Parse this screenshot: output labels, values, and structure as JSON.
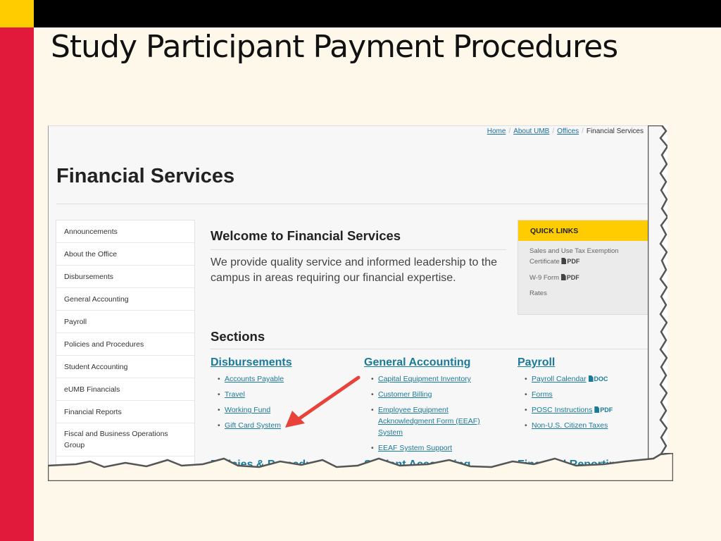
{
  "slide": {
    "title": "Study Participant Payment Procedures",
    "colors": {
      "accent_yellow": "#ffcc00",
      "accent_red": "#e11a3c",
      "top_bar": "#000000",
      "background": "#fdf8ea"
    }
  },
  "website": {
    "breadcrumb": [
      {
        "label": "Home",
        "link": true
      },
      {
        "label": "About UMB",
        "link": true
      },
      {
        "label": "Offices",
        "link": true
      },
      {
        "label": "Financial Services",
        "link": false
      }
    ],
    "breadcrumb_separator": "/",
    "page_title": "Financial Services",
    "sidebar": {
      "items": [
        "Announcements",
        "About the Office",
        "Disbursements",
        "General Accounting",
        "Payroll",
        "Policies and Procedures",
        "Student Accounting",
        "eUMB Financials",
        "Financial Reports",
        "Fiscal and Business Operations Group"
      ]
    },
    "welcome": {
      "title": "Welcome to Financial Services",
      "text": "We provide quality service and informed leadership to the campus in areas requiring our financial expertise."
    },
    "quick_links": {
      "header": "QUICK LINKS",
      "items": [
        {
          "label": "Sales and Use Tax Exemption Certificate",
          "badge": "PDF"
        },
        {
          "label": "W-9 Form",
          "badge": "PDF"
        },
        {
          "label": "Rates",
          "badge": ""
        }
      ],
      "colors": {
        "header_bg": "#ffcc00"
      }
    },
    "sections": {
      "title": "Sections",
      "columns": [
        {
          "heading": "Disbursements",
          "links": [
            {
              "label": "Accounts Payable",
              "badge": ""
            },
            {
              "label": "Travel",
              "badge": ""
            },
            {
              "label": "Working Fund",
              "badge": ""
            },
            {
              "label": "Gift Card System",
              "badge": ""
            }
          ]
        },
        {
          "heading": "General Accounting",
          "links": [
            {
              "label": "Capital Equipment Inventory",
              "badge": ""
            },
            {
              "label": "Customer Billing",
              "badge": ""
            },
            {
              "label": "Employee Equipment Acknowledgment Form (EEAF) System",
              "badge": ""
            },
            {
              "label": "EEAF System Support",
              "badge": ""
            }
          ]
        },
        {
          "heading": "Payroll",
          "links": [
            {
              "label": "Payroll Calendar",
              "badge": "DOC"
            },
            {
              "label": "Forms",
              "badge": ""
            },
            {
              "label": "POSC Instructions",
              "badge": "PDF"
            },
            {
              "label": "Non-U.S. Citizen Taxes",
              "badge": ""
            }
          ]
        }
      ],
      "bottom_headings": [
        "Policies & Procedures",
        "Student Accounting",
        "Financial Reporting"
      ],
      "link_color": "#1a7a9a"
    },
    "annotation": {
      "type": "arrow",
      "color": "#e8423a",
      "points_to": "Gift Card System"
    }
  }
}
